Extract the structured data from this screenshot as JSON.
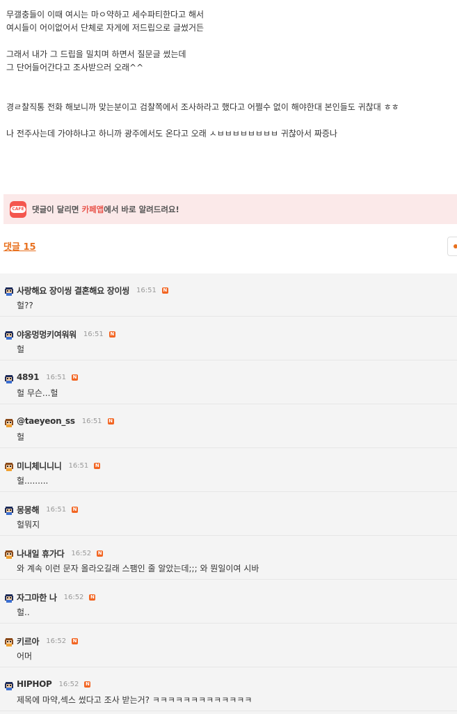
{
  "article": {
    "lines": [
      "무갤충들이 이때 여시는 마ㅇ약하고 세수파티한다고 해서",
      "여시들이 어이없어서 단체로 자게에 저드립으로 글썼거든",
      "그래서 내가 그 드립을 밀치며 하면서 질문글 썼는데",
      "그 단어들어간다고 조사받으러 오래^^",
      "경ㄹ찰직통 전화 해보니까 맞는분이고 검찰쪽에서 조사하라고 했다고 어쩔수 없이 해야한대 본인들도 귀찮대 ㅎㅎ",
      "나 전주사는데 가야하냐고 하니까 광주에서도 온다고 오래 ㅅㅂㅂㅂㅂㅂㅂㅂㅂ 귀찮아서 짜증나"
    ]
  },
  "banner": {
    "logo_text": "CAFE",
    "text_before": "댓글이 달리면 ",
    "text_accent": "카페앱",
    "text_after": "에서 바로 알려드려요!"
  },
  "comment_count_label": "댓글 15",
  "comments": [
    {
      "nick": "사랑해요 장이씽 결혼해요 장이씽",
      "time": "16:51",
      "text": "헐??",
      "avatar": "blue"
    },
    {
      "nick": "야옹멍멍키여워워",
      "time": "16:51",
      "text": "헐",
      "avatar": "blue"
    },
    {
      "nick": "4891",
      "time": "16:51",
      "text": "헐 무슨...헐",
      "avatar": "blue"
    },
    {
      "nick": "@taeyeon_ss",
      "time": "16:51",
      "text": "헐",
      "avatar": "orange"
    },
    {
      "nick": "미니체니니니",
      "time": "16:51",
      "text": "헐.........",
      "avatar": "orange"
    },
    {
      "nick": "몽몽해",
      "time": "16:51",
      "text": "헐뭐지",
      "avatar": "blue"
    },
    {
      "nick": "나내일 휴가다",
      "time": "16:52",
      "text": "와 계속 이런 문자 올라오길래 스팸인 줄 알았는데;;; 와 뭔일이여 시바",
      "avatar": "orange"
    },
    {
      "nick": "자그마한 나",
      "time": "16:52",
      "text": "헐..",
      "avatar": "blue"
    },
    {
      "nick": "키르아",
      "time": "16:52",
      "text": "어머",
      "avatar": "orange"
    },
    {
      "nick": "HIPHOP",
      "time": "16:52",
      "text": "제목에 마약,섹스 썼다고 조사 받는거? ㅋㅋㅋㅋㅋㅋㅋㅋㅋㅋㅋㅋㅋ",
      "avatar": "blue"
    }
  ],
  "new_badge": "N",
  "colors": {
    "accent": "#e8701e",
    "banner_bg": "#fbe9e9",
    "cafe_red": "#f4564e",
    "new_badge": "#f26522",
    "comments_bg": "#f4f4f4"
  }
}
